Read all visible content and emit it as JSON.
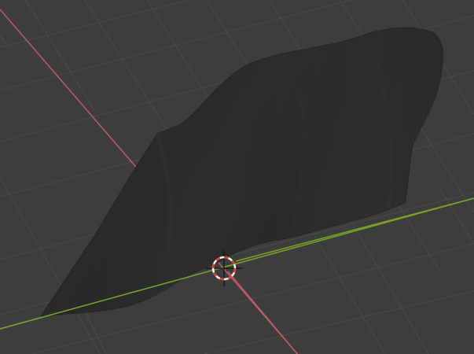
{
  "viewport": {
    "background_color": "#3d3d3d",
    "grid_color": "#4a4a4a",
    "x_axis_color": "#c05a68",
    "y_axis_color": "#7aa32d",
    "mesh_color": "#2d2d2d",
    "mesh_edge_color": "#262626",
    "cursor_icon": "3d-cursor-icon"
  }
}
